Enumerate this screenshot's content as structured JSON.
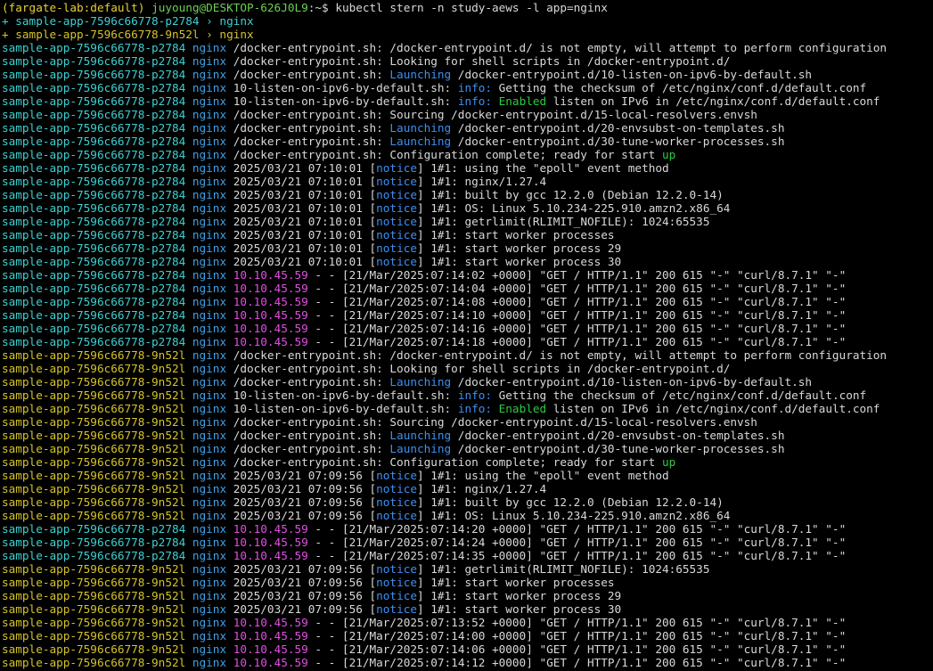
{
  "prompt": {
    "open": "(",
    "context": "fargate-lab:default",
    "close": ") ",
    "userhost": "juyoung@DESKTOP-626J0L9",
    "path": ":~$ ",
    "command": "kubectl stern -n study-aews -l app=nginx"
  },
  "lines": [
    [
      {
        "t": "+ sample-app-7596c66778-p2784 › nginx",
        "c": "pod1p"
      }
    ],
    [
      {
        "t": "+ sample-app-7596c66778-9n52l › nginx",
        "c": "pod2p"
      }
    ],
    [
      {
        "t": "sample-app-7596c66778-p2784",
        "c": "pod1"
      },
      {
        "t": " "
      },
      {
        "t": "nginx",
        "c": "ctr"
      },
      {
        "t": " /docker-entrypoint.sh: /docker-entrypoint.d/ is not empty, will attempt to perform configuration"
      }
    ],
    [
      {
        "t": "sample-app-7596c66778-p2784",
        "c": "pod1"
      },
      {
        "t": " "
      },
      {
        "t": "nginx",
        "c": "ctr"
      },
      {
        "t": " /docker-entrypoint.sh: Looking for shell scripts in /docker-entrypoint.d/"
      }
    ],
    [
      {
        "t": "sample-app-7596c66778-p2784",
        "c": "pod1"
      },
      {
        "t": " "
      },
      {
        "t": "nginx",
        "c": "ctr"
      },
      {
        "t": " /docker-entrypoint.sh: "
      },
      {
        "t": "Launching",
        "c": "blue"
      },
      {
        "t": " /docker-entrypoint.d/10-listen-on-ipv6-by-default.sh"
      }
    ],
    [
      {
        "t": "sample-app-7596c66778-p2784",
        "c": "pod1"
      },
      {
        "t": " "
      },
      {
        "t": "nginx",
        "c": "ctr"
      },
      {
        "t": " 10-listen-on-ipv6-by-default.sh: "
      },
      {
        "t": "info:",
        "c": "blue"
      },
      {
        "t": " Getting the checksum of /etc/nginx/conf.d/default.conf"
      }
    ],
    [
      {
        "t": "sample-app-7596c66778-p2784",
        "c": "pod1"
      },
      {
        "t": " "
      },
      {
        "t": "nginx",
        "c": "ctr"
      },
      {
        "t": " 10-listen-on-ipv6-by-default.sh: "
      },
      {
        "t": "info:",
        "c": "blue"
      },
      {
        "t": " "
      },
      {
        "t": "Enabled",
        "c": "green"
      },
      {
        "t": " listen on IPv6 in /etc/nginx/conf.d/default.conf"
      }
    ],
    [
      {
        "t": "sample-app-7596c66778-p2784",
        "c": "pod1"
      },
      {
        "t": " "
      },
      {
        "t": "nginx",
        "c": "ctr"
      },
      {
        "t": " /docker-entrypoint.sh: Sourcing /docker-entrypoint.d/15-local-resolvers.envsh"
      }
    ],
    [
      {
        "t": "sample-app-7596c66778-p2784",
        "c": "pod1"
      },
      {
        "t": " "
      },
      {
        "t": "nginx",
        "c": "ctr"
      },
      {
        "t": " /docker-entrypoint.sh: "
      },
      {
        "t": "Launching",
        "c": "blue"
      },
      {
        "t": " /docker-entrypoint.d/20-envsubst-on-templates.sh"
      }
    ],
    [
      {
        "t": "sample-app-7596c66778-p2784",
        "c": "pod1"
      },
      {
        "t": " "
      },
      {
        "t": "nginx",
        "c": "ctr"
      },
      {
        "t": " /docker-entrypoint.sh: "
      },
      {
        "t": "Launching",
        "c": "blue"
      },
      {
        "t": " /docker-entrypoint.d/30-tune-worker-processes.sh"
      }
    ],
    [
      {
        "t": "sample-app-7596c66778-p2784",
        "c": "pod1"
      },
      {
        "t": " "
      },
      {
        "t": "nginx",
        "c": "ctr"
      },
      {
        "t": " /docker-entrypoint.sh: Configuration complete; ready for start "
      },
      {
        "t": "up",
        "c": "green"
      }
    ],
    [
      {
        "t": "sample-app-7596c66778-p2784",
        "c": "pod1"
      },
      {
        "t": " "
      },
      {
        "t": "nginx",
        "c": "ctr"
      },
      {
        "t": " 2025/03/21 07:10:01 ["
      },
      {
        "t": "notice",
        "c": "blue"
      },
      {
        "t": "] 1#1: using the \"epoll\" event method"
      }
    ],
    [
      {
        "t": "sample-app-7596c66778-p2784",
        "c": "pod1"
      },
      {
        "t": " "
      },
      {
        "t": "nginx",
        "c": "ctr"
      },
      {
        "t": " 2025/03/21 07:10:01 ["
      },
      {
        "t": "notice",
        "c": "blue"
      },
      {
        "t": "] 1#1: nginx/1.27.4"
      }
    ],
    [
      {
        "t": "sample-app-7596c66778-p2784",
        "c": "pod1"
      },
      {
        "t": " "
      },
      {
        "t": "nginx",
        "c": "ctr"
      },
      {
        "t": " 2025/03/21 07:10:01 ["
      },
      {
        "t": "notice",
        "c": "blue"
      },
      {
        "t": "] 1#1: built by gcc 12.2.0 (Debian 12.2.0-14)"
      }
    ],
    [
      {
        "t": "sample-app-7596c66778-p2784",
        "c": "pod1"
      },
      {
        "t": " "
      },
      {
        "t": "nginx",
        "c": "ctr"
      },
      {
        "t": " 2025/03/21 07:10:01 ["
      },
      {
        "t": "notice",
        "c": "blue"
      },
      {
        "t": "] 1#1: OS: Linux 5.10.234-225.910.amzn2.x86_64"
      }
    ],
    [
      {
        "t": "sample-app-7596c66778-p2784",
        "c": "pod1"
      },
      {
        "t": " "
      },
      {
        "t": "nginx",
        "c": "ctr"
      },
      {
        "t": " 2025/03/21 07:10:01 ["
      },
      {
        "t": "notice",
        "c": "blue"
      },
      {
        "t": "] 1#1: getrlimit(RLIMIT_NOFILE): 1024:65535"
      }
    ],
    [
      {
        "t": "sample-app-7596c66778-p2784",
        "c": "pod1"
      },
      {
        "t": " "
      },
      {
        "t": "nginx",
        "c": "ctr"
      },
      {
        "t": " 2025/03/21 07:10:01 ["
      },
      {
        "t": "notice",
        "c": "blue"
      },
      {
        "t": "] 1#1: start worker processes"
      }
    ],
    [
      {
        "t": "sample-app-7596c66778-p2784",
        "c": "pod1"
      },
      {
        "t": " "
      },
      {
        "t": "nginx",
        "c": "ctr"
      },
      {
        "t": " 2025/03/21 07:10:01 ["
      },
      {
        "t": "notice",
        "c": "blue"
      },
      {
        "t": "] 1#1: start worker process 29"
      }
    ],
    [
      {
        "t": "sample-app-7596c66778-p2784",
        "c": "pod1"
      },
      {
        "t": " "
      },
      {
        "t": "nginx",
        "c": "ctr"
      },
      {
        "t": " 2025/03/21 07:10:01 ["
      },
      {
        "t": "notice",
        "c": "blue"
      },
      {
        "t": "] 1#1: start worker process 30"
      }
    ],
    [
      {
        "t": "sample-app-7596c66778-p2784",
        "c": "pod1"
      },
      {
        "t": " "
      },
      {
        "t": "nginx",
        "c": "ctr"
      },
      {
        "t": " "
      },
      {
        "t": "10.10.45.59",
        "c": "ip"
      },
      {
        "t": " - - [21/Mar/2025:07:14:02 +0000] \"GET / HTTP/1.1\" 200 615 \"-\" \"curl/8.7.1\" \"-\""
      }
    ],
    [
      {
        "t": "sample-app-7596c66778-p2784",
        "c": "pod1"
      },
      {
        "t": " "
      },
      {
        "t": "nginx",
        "c": "ctr"
      },
      {
        "t": " "
      },
      {
        "t": "10.10.45.59",
        "c": "ip"
      },
      {
        "t": " - - [21/Mar/2025:07:14:04 +0000] \"GET / HTTP/1.1\" 200 615 \"-\" \"curl/8.7.1\" \"-\""
      }
    ],
    [
      {
        "t": "sample-app-7596c66778-p2784",
        "c": "pod1"
      },
      {
        "t": " "
      },
      {
        "t": "nginx",
        "c": "ctr"
      },
      {
        "t": " "
      },
      {
        "t": "10.10.45.59",
        "c": "ip"
      },
      {
        "t": " - - [21/Mar/2025:07:14:08 +0000] \"GET / HTTP/1.1\" 200 615 \"-\" \"curl/8.7.1\" \"-\""
      }
    ],
    [
      {
        "t": "sample-app-7596c66778-p2784",
        "c": "pod1"
      },
      {
        "t": " "
      },
      {
        "t": "nginx",
        "c": "ctr"
      },
      {
        "t": " "
      },
      {
        "t": "10.10.45.59",
        "c": "ip"
      },
      {
        "t": " - - [21/Mar/2025:07:14:10 +0000] \"GET / HTTP/1.1\" 200 615 \"-\" \"curl/8.7.1\" \"-\""
      }
    ],
    [
      {
        "t": "sample-app-7596c66778-p2784",
        "c": "pod1"
      },
      {
        "t": " "
      },
      {
        "t": "nginx",
        "c": "ctr"
      },
      {
        "t": " "
      },
      {
        "t": "10.10.45.59",
        "c": "ip"
      },
      {
        "t": " - - [21/Mar/2025:07:14:16 +0000] \"GET / HTTP/1.1\" 200 615 \"-\" \"curl/8.7.1\" \"-\""
      }
    ],
    [
      {
        "t": "sample-app-7596c66778-p2784",
        "c": "pod1"
      },
      {
        "t": " "
      },
      {
        "t": "nginx",
        "c": "ctr"
      },
      {
        "t": " "
      },
      {
        "t": "10.10.45.59",
        "c": "ip"
      },
      {
        "t": " - - [21/Mar/2025:07:14:18 +0000] \"GET / HTTP/1.1\" 200 615 \"-\" \"curl/8.7.1\" \"-\""
      }
    ],
    [
      {
        "t": "sample-app-7596c66778-9n52l",
        "c": "pod2"
      },
      {
        "t": " "
      },
      {
        "t": "nginx",
        "c": "ctr"
      },
      {
        "t": " /docker-entrypoint.sh: /docker-entrypoint.d/ is not empty, will attempt to perform configuration"
      }
    ],
    [
      {
        "t": "sample-app-7596c66778-9n52l",
        "c": "pod2"
      },
      {
        "t": " "
      },
      {
        "t": "nginx",
        "c": "ctr"
      },
      {
        "t": " /docker-entrypoint.sh: Looking for shell scripts in /docker-entrypoint.d/"
      }
    ],
    [
      {
        "t": "sample-app-7596c66778-9n52l",
        "c": "pod2"
      },
      {
        "t": " "
      },
      {
        "t": "nginx",
        "c": "ctr"
      },
      {
        "t": " /docker-entrypoint.sh: "
      },
      {
        "t": "Launching",
        "c": "blue"
      },
      {
        "t": " /docker-entrypoint.d/10-listen-on-ipv6-by-default.sh"
      }
    ],
    [
      {
        "t": "sample-app-7596c66778-9n52l",
        "c": "pod2"
      },
      {
        "t": " "
      },
      {
        "t": "nginx",
        "c": "ctr"
      },
      {
        "t": " 10-listen-on-ipv6-by-default.sh: "
      },
      {
        "t": "info:",
        "c": "blue"
      },
      {
        "t": " Getting the checksum of /etc/nginx/conf.d/default.conf"
      }
    ],
    [
      {
        "t": "sample-app-7596c66778-9n52l",
        "c": "pod2"
      },
      {
        "t": " "
      },
      {
        "t": "nginx",
        "c": "ctr"
      },
      {
        "t": " 10-listen-on-ipv6-by-default.sh: "
      },
      {
        "t": "info:",
        "c": "blue"
      },
      {
        "t": " "
      },
      {
        "t": "Enabled",
        "c": "green"
      },
      {
        "t": " listen on IPv6 in /etc/nginx/conf.d/default.conf"
      }
    ],
    [
      {
        "t": "sample-app-7596c66778-9n52l",
        "c": "pod2"
      },
      {
        "t": " "
      },
      {
        "t": "nginx",
        "c": "ctr"
      },
      {
        "t": " /docker-entrypoint.sh: Sourcing /docker-entrypoint.d/15-local-resolvers.envsh"
      }
    ],
    [
      {
        "t": "sample-app-7596c66778-9n52l",
        "c": "pod2"
      },
      {
        "t": " "
      },
      {
        "t": "nginx",
        "c": "ctr"
      },
      {
        "t": " /docker-entrypoint.sh: "
      },
      {
        "t": "Launching",
        "c": "blue"
      },
      {
        "t": " /docker-entrypoint.d/20-envsubst-on-templates.sh"
      }
    ],
    [
      {
        "t": "sample-app-7596c66778-9n52l",
        "c": "pod2"
      },
      {
        "t": " "
      },
      {
        "t": "nginx",
        "c": "ctr"
      },
      {
        "t": " /docker-entrypoint.sh: "
      },
      {
        "t": "Launching",
        "c": "blue"
      },
      {
        "t": " /docker-entrypoint.d/30-tune-worker-processes.sh"
      }
    ],
    [
      {
        "t": "sample-app-7596c66778-9n52l",
        "c": "pod2"
      },
      {
        "t": " "
      },
      {
        "t": "nginx",
        "c": "ctr"
      },
      {
        "t": " /docker-entrypoint.sh: Configuration complete; ready for start "
      },
      {
        "t": "up",
        "c": "green"
      }
    ],
    [
      {
        "t": "sample-app-7596c66778-9n52l",
        "c": "pod2"
      },
      {
        "t": " "
      },
      {
        "t": "nginx",
        "c": "ctr"
      },
      {
        "t": " 2025/03/21 07:09:56 ["
      },
      {
        "t": "notice",
        "c": "blue"
      },
      {
        "t": "] 1#1: using the \"epoll\" event method"
      }
    ],
    [
      {
        "t": "sample-app-7596c66778-9n52l",
        "c": "pod2"
      },
      {
        "t": " "
      },
      {
        "t": "nginx",
        "c": "ctr"
      },
      {
        "t": " 2025/03/21 07:09:56 ["
      },
      {
        "t": "notice",
        "c": "blue"
      },
      {
        "t": "] 1#1: nginx/1.27.4"
      }
    ],
    [
      {
        "t": "sample-app-7596c66778-9n52l",
        "c": "pod2"
      },
      {
        "t": " "
      },
      {
        "t": "nginx",
        "c": "ctr"
      },
      {
        "t": " 2025/03/21 07:09:56 ["
      },
      {
        "t": "notice",
        "c": "blue"
      },
      {
        "t": "] 1#1: built by gcc 12.2.0 (Debian 12.2.0-14)"
      }
    ],
    [
      {
        "t": "sample-app-7596c66778-9n52l",
        "c": "pod2"
      },
      {
        "t": " "
      },
      {
        "t": "nginx",
        "c": "ctr"
      },
      {
        "t": " 2025/03/21 07:09:56 ["
      },
      {
        "t": "notice",
        "c": "blue"
      },
      {
        "t": "] 1#1: OS: Linux 5.10.234-225.910.amzn2.x86_64"
      }
    ],
    [
      {
        "t": "sample-app-7596c66778-p2784",
        "c": "pod1"
      },
      {
        "t": " "
      },
      {
        "t": "nginx",
        "c": "ctr"
      },
      {
        "t": " "
      },
      {
        "t": "10.10.45.59",
        "c": "ip"
      },
      {
        "t": " - - [21/Mar/2025:07:14:20 +0000] \"GET / HTTP/1.1\" 200 615 \"-\" \"curl/8.7.1\" \"-\""
      }
    ],
    [
      {
        "t": "sample-app-7596c66778-p2784",
        "c": "pod1"
      },
      {
        "t": " "
      },
      {
        "t": "nginx",
        "c": "ctr"
      },
      {
        "t": " "
      },
      {
        "t": "10.10.45.59",
        "c": "ip"
      },
      {
        "t": " - - [21/Mar/2025:07:14:24 +0000] \"GET / HTTP/1.1\" 200 615 \"-\" \"curl/8.7.1\" \"-\""
      }
    ],
    [
      {
        "t": "sample-app-7596c66778-p2784",
        "c": "pod1"
      },
      {
        "t": " "
      },
      {
        "t": "nginx",
        "c": "ctr"
      },
      {
        "t": " "
      },
      {
        "t": "10.10.45.59",
        "c": "ip"
      },
      {
        "t": " - - [21/Mar/2025:07:14:35 +0000] \"GET / HTTP/1.1\" 200 615 \"-\" \"curl/8.7.1\" \"-\""
      }
    ],
    [
      {
        "t": "sample-app-7596c66778-9n52l",
        "c": "pod2"
      },
      {
        "t": " "
      },
      {
        "t": "nginx",
        "c": "ctr"
      },
      {
        "t": " 2025/03/21 07:09:56 ["
      },
      {
        "t": "notice",
        "c": "blue"
      },
      {
        "t": "] 1#1: getrlimit(RLIMIT_NOFILE): 1024:65535"
      }
    ],
    [
      {
        "t": "sample-app-7596c66778-9n52l",
        "c": "pod2"
      },
      {
        "t": " "
      },
      {
        "t": "nginx",
        "c": "ctr"
      },
      {
        "t": " 2025/03/21 07:09:56 ["
      },
      {
        "t": "notice",
        "c": "blue"
      },
      {
        "t": "] 1#1: start worker processes"
      }
    ],
    [
      {
        "t": "sample-app-7596c66778-9n52l",
        "c": "pod2"
      },
      {
        "t": " "
      },
      {
        "t": "nginx",
        "c": "ctr"
      },
      {
        "t": " 2025/03/21 07:09:56 ["
      },
      {
        "t": "notice",
        "c": "blue"
      },
      {
        "t": "] 1#1: start worker process 29"
      }
    ],
    [
      {
        "t": "sample-app-7596c66778-9n52l",
        "c": "pod2"
      },
      {
        "t": " "
      },
      {
        "t": "nginx",
        "c": "ctr"
      },
      {
        "t": " 2025/03/21 07:09:56 ["
      },
      {
        "t": "notice",
        "c": "blue"
      },
      {
        "t": "] 1#1: start worker process 30"
      }
    ],
    [
      {
        "t": "sample-app-7596c66778-9n52l",
        "c": "pod2"
      },
      {
        "t": " "
      },
      {
        "t": "nginx",
        "c": "ctr"
      },
      {
        "t": " "
      },
      {
        "t": "10.10.45.59",
        "c": "ip"
      },
      {
        "t": " - - [21/Mar/2025:07:13:52 +0000] \"GET / HTTP/1.1\" 200 615 \"-\" \"curl/8.7.1\" \"-\""
      }
    ],
    [
      {
        "t": "sample-app-7596c66778-9n52l",
        "c": "pod2"
      },
      {
        "t": " "
      },
      {
        "t": "nginx",
        "c": "ctr"
      },
      {
        "t": " "
      },
      {
        "t": "10.10.45.59",
        "c": "ip"
      },
      {
        "t": " - - [21/Mar/2025:07:14:00 +0000] \"GET / HTTP/1.1\" 200 615 \"-\" \"curl/8.7.1\" \"-\""
      }
    ],
    [
      {
        "t": "sample-app-7596c66778-9n52l",
        "c": "pod2"
      },
      {
        "t": " "
      },
      {
        "t": "nginx",
        "c": "ctr"
      },
      {
        "t": " "
      },
      {
        "t": "10.10.45.59",
        "c": "ip"
      },
      {
        "t": " - - [21/Mar/2025:07:14:06 +0000] \"GET / HTTP/1.1\" 200 615 \"-\" \"curl/8.7.1\" \"-\""
      }
    ],
    [
      {
        "t": "sample-app-7596c66778-9n52l",
        "c": "pod2"
      },
      {
        "t": " "
      },
      {
        "t": "nginx",
        "c": "ctr"
      },
      {
        "t": " "
      },
      {
        "t": "10.10.45.59",
        "c": "ip"
      },
      {
        "t": " - - [21/Mar/2025:07:14:12 +0000] \"GET / HTTP/1.1\" 200 615 \"-\" \"curl/8.7.1\" \"-\""
      }
    ]
  ]
}
